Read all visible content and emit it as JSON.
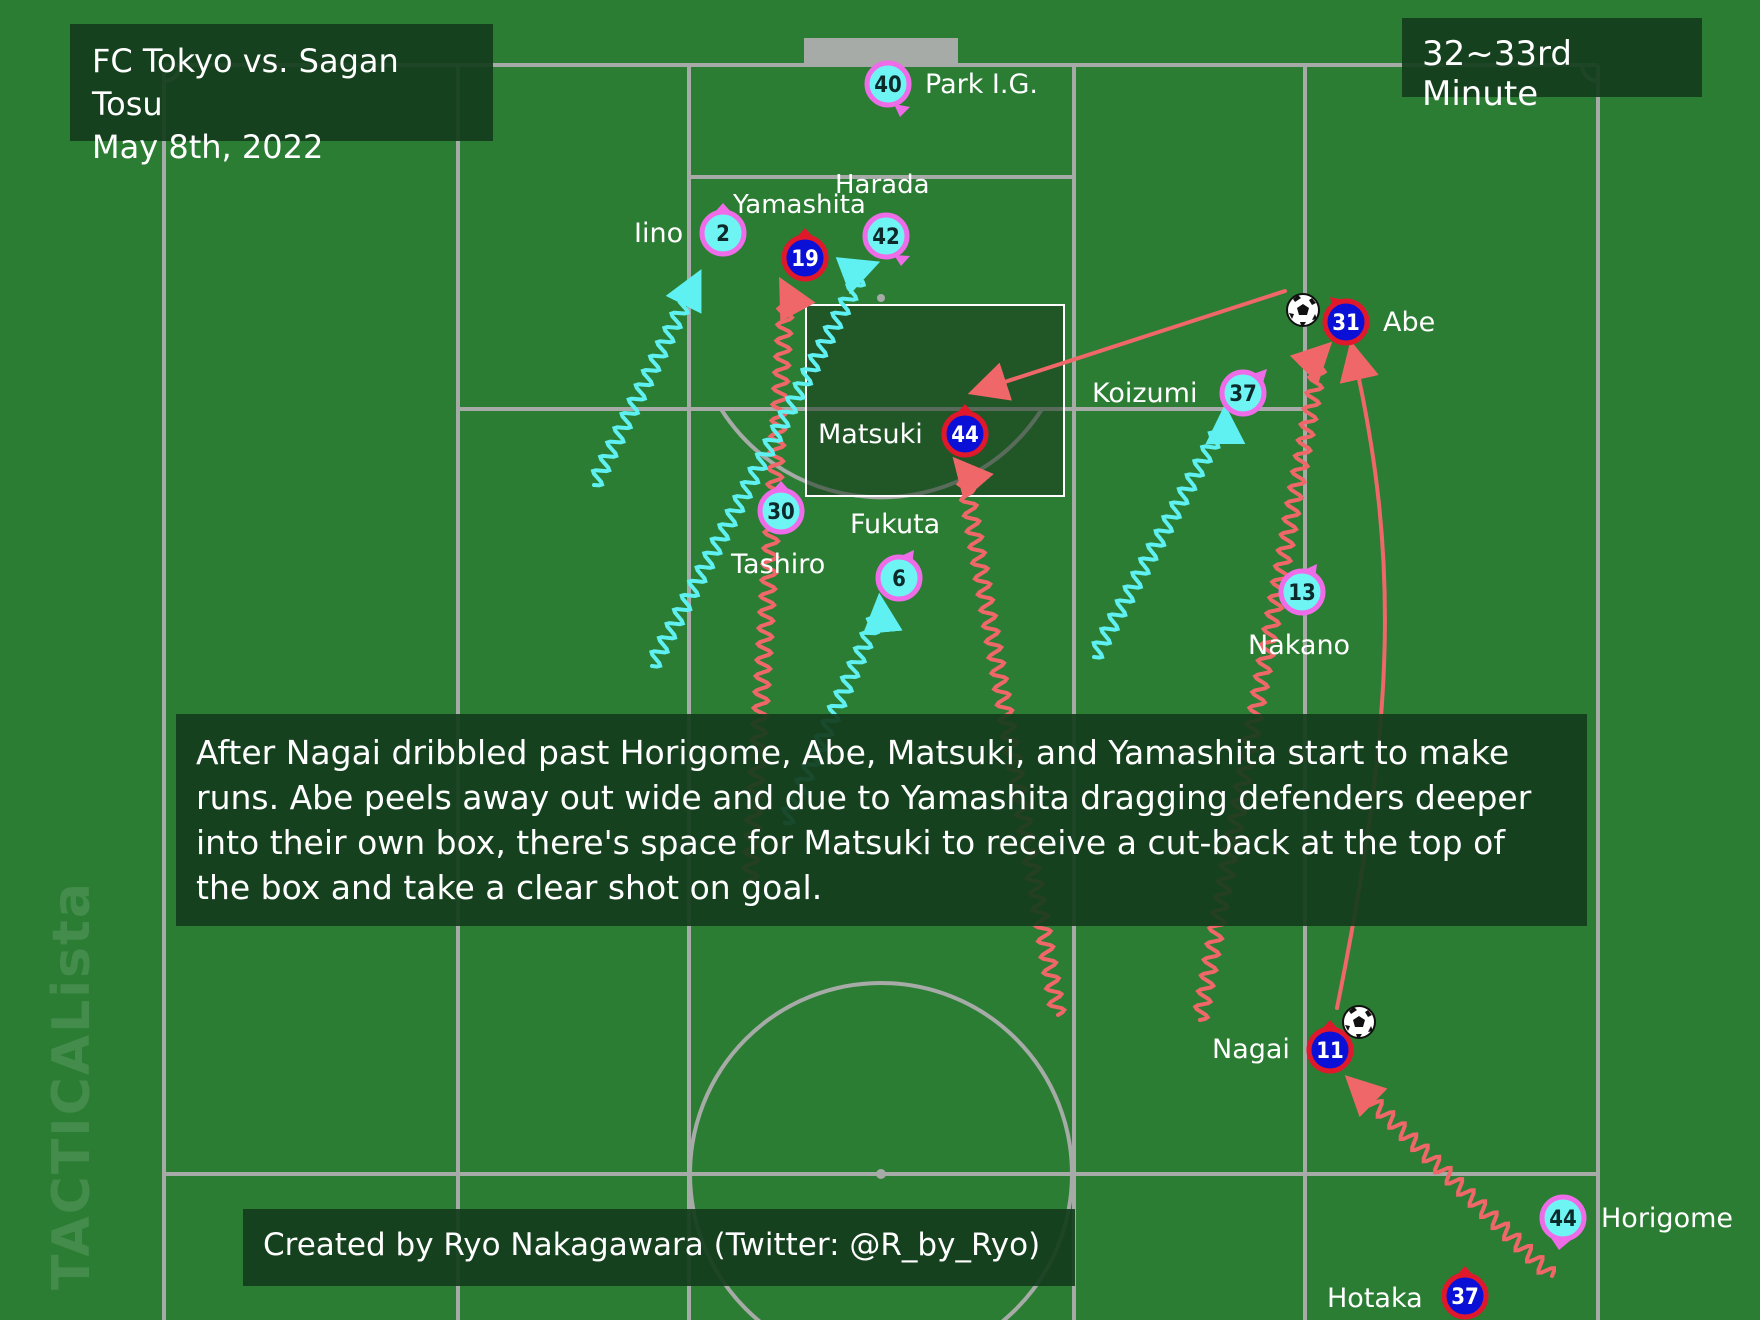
{
  "title": {
    "line1": "FC Tokyo vs. Sagan Tosu",
    "line2": "May 8th, 2022"
  },
  "minute": "32~33rd Minute",
  "description": "After Nagai dribbled past Horigome, Abe, Matsuki, and Yamashita start to make runs. Abe peels away out wide and due to Yamashita dragging defenders deeper into their own box, there's space for Matsuki to receive a cut-back at the top of the box and take a clear shot on goal.",
  "credit": "Created by Ryo Nakagawara (Twitter: @R_by_Ryo)",
  "watermark": "TACTICALista",
  "colors": {
    "pitch": "#2b7d33",
    "lines": "#a7aba7",
    "attacking_team_fill": "#0a10d6",
    "attacking_team_ring": "#e0182b",
    "defending_team_fill": "#6ff4f4",
    "defending_team_ring": "#ef6ce8",
    "attack_arrow": "#f0676a",
    "defense_arrow": "#5ff0f2",
    "panel": "#143c1c"
  },
  "attacking_players": [
    {
      "name": "Yamashita",
      "number": "19"
    },
    {
      "name": "Abe",
      "number": "31"
    },
    {
      "name": "Matsuki",
      "number": "44"
    },
    {
      "name": "Nagai",
      "number": "11"
    },
    {
      "name": "Hotaka",
      "number": "37"
    }
  ],
  "defending_players": [
    {
      "name": "Park I.G.",
      "number": "40"
    },
    {
      "name": "Iino",
      "number": "2"
    },
    {
      "name": "Harada",
      "number": "42"
    },
    {
      "name": "Koizumi",
      "number": "37"
    },
    {
      "name": "Tashiro",
      "number": "30"
    },
    {
      "name": "Fukuta",
      "number": "6"
    },
    {
      "name": "Nakano",
      "number": "13"
    },
    {
      "name": "Horigome",
      "number": "44"
    }
  ]
}
